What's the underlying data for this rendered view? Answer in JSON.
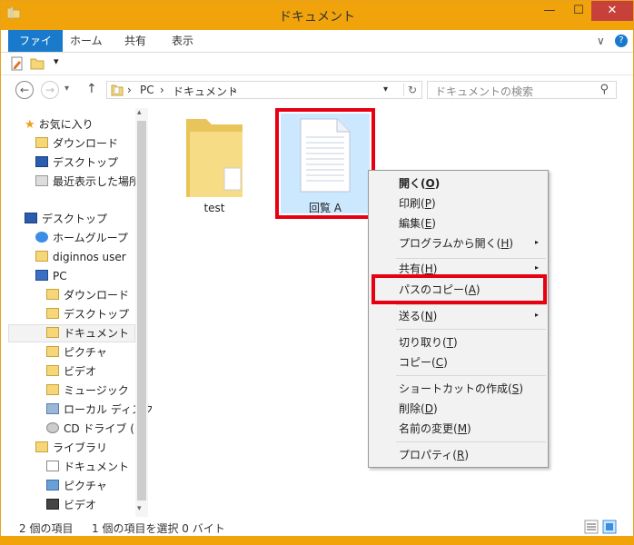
{
  "window": {
    "title": "ドキュメント",
    "minimize": "—",
    "maximize": "☐",
    "close": "✕"
  },
  "ribbon": {
    "tabs": [
      "ファイル",
      "ホーム",
      "共有",
      "表示"
    ],
    "collapse": "∨",
    "help": "?"
  },
  "qat": {
    "dropdown": "▾"
  },
  "nav": {
    "back": "←",
    "forward": "→",
    "dropdown": "▾",
    "up": "↑",
    "address": [
      "PC",
      "ドキュメント"
    ],
    "address_sep": "›",
    "address_dropdown": "▾",
    "refresh": "↻",
    "search_placeholder": "ドキュメントの検索",
    "search_icon": "⚲"
  },
  "nav_pane": {
    "items": [
      {
        "label": "お気に入り",
        "icon": "star-icon"
      },
      {
        "label": "ダウンロード",
        "icon": "download-folder-icon"
      },
      {
        "label": "デスクトップ",
        "icon": "desktop-icon"
      },
      {
        "label": "最近表示した場所",
        "icon": "recent-places-icon"
      },
      {
        "label": "デスクトップ",
        "icon": "desktop-icon"
      },
      {
        "label": "ホームグループ",
        "icon": "homegroup-icon"
      },
      {
        "label": "diginnos user",
        "icon": "user-folder-icon"
      },
      {
        "label": "PC",
        "icon": "pc-icon"
      },
      {
        "label": "ダウンロード",
        "icon": "download-folder-icon"
      },
      {
        "label": "デスクトップ",
        "icon": "desktop-folder-icon"
      },
      {
        "label": "ドキュメント",
        "icon": "documents-folder-icon"
      },
      {
        "label": "ピクチャ",
        "icon": "pictures-folder-icon"
      },
      {
        "label": "ビデオ",
        "icon": "videos-folder-icon"
      },
      {
        "label": "ミュージック",
        "icon": "music-folder-icon"
      },
      {
        "label": "ローカル ディスク",
        "icon": "local-disk-icon"
      },
      {
        "label": "CD ドライブ (D:",
        "icon": "cd-drive-icon"
      },
      {
        "label": "ライブラリ",
        "icon": "libraries-icon"
      },
      {
        "label": "ドキュメント",
        "icon": "documents-library-icon"
      },
      {
        "label": "ピクチャ",
        "icon": "pictures-library-icon"
      },
      {
        "label": "ビデオ",
        "icon": "videos-library-icon"
      }
    ],
    "scroll_up": "▴",
    "scroll_down": "▾"
  },
  "files": [
    {
      "name": "test",
      "icon": "folder-icon"
    },
    {
      "name": "回覧 A",
      "icon": "text-document-icon"
    }
  ],
  "context_menu": {
    "open": {
      "text": "開く(",
      "key": "O",
      "end": ")"
    },
    "print": {
      "text": "印刷(",
      "key": "P",
      "end": ")"
    },
    "edit": {
      "text": "編集(",
      "key": "E",
      "end": ")"
    },
    "open_with": {
      "text": "プログラムから開く(",
      "key": "H",
      "end": ")"
    },
    "share": {
      "text": "共有(",
      "key": "H",
      "end": ")"
    },
    "copy_path": {
      "text": "パスのコピー(",
      "key": "A",
      "end": ")"
    },
    "send_to": {
      "text": "送る(",
      "key": "N",
      "end": ")"
    },
    "cut": {
      "text": "切り取り(",
      "key": "T",
      "end": ")"
    },
    "copy": {
      "text": "コピー(",
      "key": "C",
      "end": ")"
    },
    "create_shortcut": {
      "text": "ショートカットの作成(",
      "key": "S",
      "end": ")"
    },
    "delete": {
      "text": "削除(",
      "key": "D",
      "end": ")"
    },
    "rename": {
      "text": "名前の変更(",
      "key": "M",
      "end": ")"
    },
    "properties": {
      "text": "プロパティ(",
      "key": "R",
      "end": ")"
    },
    "submenu_arrow": "▸"
  },
  "status": {
    "item_count": "2 個の項目",
    "selection": "1 個の項目を選択  0 バイト"
  },
  "colors": {
    "accent": "#f0a30a",
    "file_tab": "#1979ca",
    "highlight": "#e60012",
    "selection": "#cce8ff"
  }
}
